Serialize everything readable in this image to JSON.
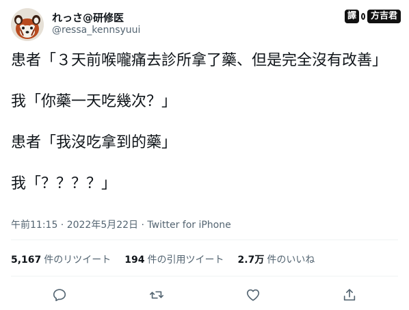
{
  "user": {
    "display_name": "れっさ@研修医",
    "handle": "@ressa_kennsyuui",
    "avatar": "red-panda-avatar"
  },
  "watermark": {
    "badge": "譯",
    "name": "方吉君"
  },
  "tweet": {
    "lines": [
      "患者「３天前喉嚨痛去診所拿了藥、但是完全沒有改善」",
      "我「你藥一天吃幾次？」",
      "患者「我沒吃拿到的藥」",
      "我「？？？？」"
    ],
    "meta": "午前11:15 · 2022年5月22日 · Twitter for iPhone"
  },
  "stats": [
    {
      "num": "5,167",
      "label": "件のリツイート"
    },
    {
      "num": "194",
      "label": "件の引用ツイート"
    },
    {
      "num": "2.7万",
      "label": "件のいいね"
    }
  ],
  "actions": [
    "reply-icon",
    "retweet-icon",
    "like-icon",
    "share-icon"
  ],
  "colors": {
    "text": "#0f1419",
    "secondary": "#536471",
    "divider": "#eff3f4"
  }
}
